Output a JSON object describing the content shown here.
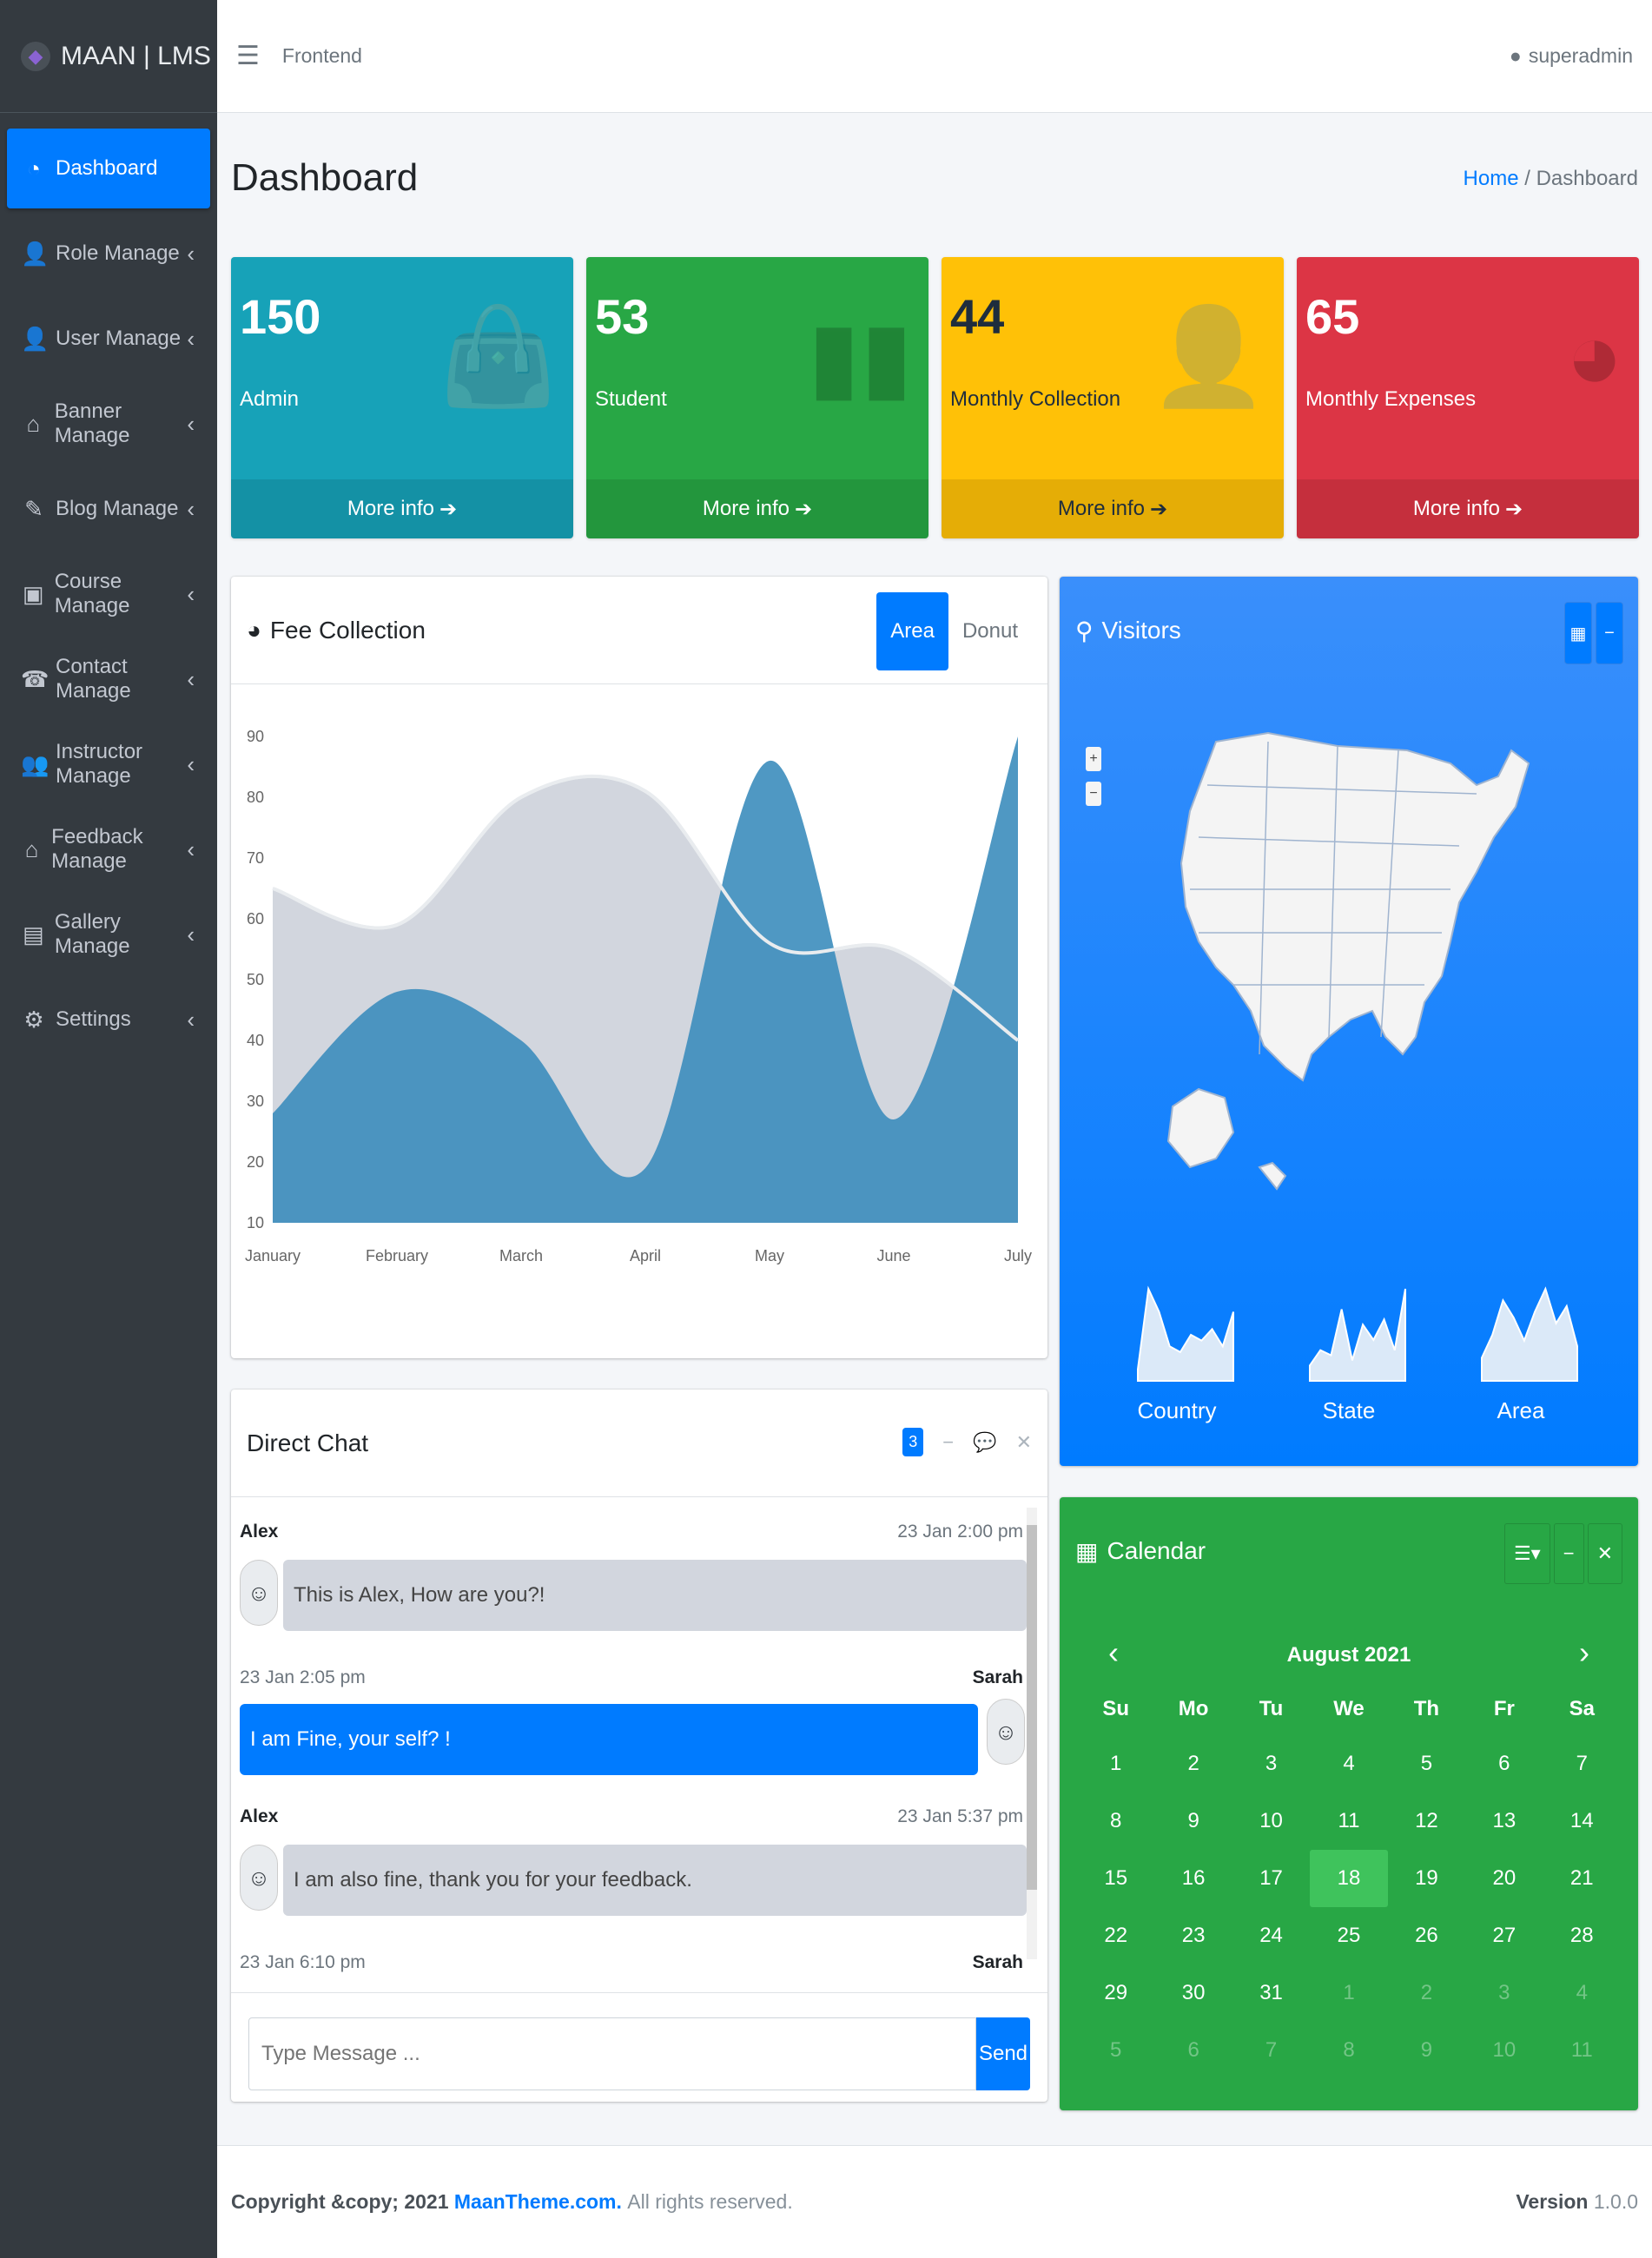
{
  "brand": {
    "name": "MAAN | LMS"
  },
  "sidebar": {
    "items": [
      {
        "label": "Dashboard",
        "icon": "dashboard-icon",
        "active": true
      },
      {
        "label": "Role Manage",
        "icon": "user-lock-icon"
      },
      {
        "label": "User Manage",
        "icon": "user-icon"
      },
      {
        "label": "Banner Manage",
        "icon": "home-icon"
      },
      {
        "label": "Blog Manage",
        "icon": "blog-icon"
      },
      {
        "label": "Course Manage",
        "icon": "course-icon"
      },
      {
        "label": "Contact Manage",
        "icon": "contact-icon"
      },
      {
        "label": "Instructor Manage",
        "icon": "users-icon"
      },
      {
        "label": "Feedback Manage",
        "icon": "home-icon"
      },
      {
        "label": "Gallery Manage",
        "icon": "gallery-icon"
      },
      {
        "label": "Settings",
        "icon": "gear-icon"
      }
    ]
  },
  "topbar": {
    "link": "Frontend",
    "user": "superadmin"
  },
  "header": {
    "title": "Dashboard",
    "breadcrumb_home": "Home",
    "breadcrumb_sep": "/",
    "breadcrumb_current": "Dashboard"
  },
  "stats": [
    {
      "value": "150",
      "label": "Admin",
      "footer": "More info",
      "color": "#17a2b8",
      "icon": "bag-icon"
    },
    {
      "value": "53",
      "label": "Student",
      "footer": "More info",
      "color": "#28a745",
      "icon": "bar-chart-icon"
    },
    {
      "value": "44",
      "label": "Monthly Collection",
      "footer": "More info",
      "color": "#ffc107",
      "icon": "user-plus-icon"
    },
    {
      "value": "65",
      "label": "Monthly Expenses",
      "footer": "More info",
      "color": "#dc3545",
      "icon": "pie-chart-icon"
    }
  ],
  "fee": {
    "title": "Fee Collection",
    "tabs": [
      "Area",
      "Donut"
    ]
  },
  "chart_data": {
    "type": "area",
    "title": "Fee Collection",
    "categories": [
      "January",
      "February",
      "March",
      "April",
      "May",
      "June",
      "July"
    ],
    "series": [
      {
        "values": [
          65,
          59,
          80,
          81,
          56,
          55,
          40
        ],
        "color": "#d2d6de"
      },
      {
        "values": [
          28,
          48,
          40,
          19,
          86,
          27,
          90
        ],
        "color": "#3c8dbc"
      }
    ],
    "ylim": [
      10,
      90
    ],
    "yticks": [
      10,
      20,
      30,
      40,
      50,
      60,
      70,
      80,
      90
    ],
    "grid": false
  },
  "visitors": {
    "title": "Visitors",
    "sparks": [
      {
        "label": "Country",
        "values": [
          10,
          80,
          60,
          30,
          25,
          40,
          35,
          45,
          30,
          60
        ]
      },
      {
        "label": "State",
        "values": [
          15,
          30,
          25,
          70,
          20,
          55,
          40,
          60,
          30,
          90
        ]
      },
      {
        "label": "Area",
        "values": [
          20,
          40,
          70,
          55,
          35,
          60,
          80,
          50,
          65,
          30
        ]
      }
    ]
  },
  "chat": {
    "title": "Direct Chat",
    "badge": "3",
    "messages": [
      {
        "name": "Alex",
        "time": "23 Jan 2:00 pm",
        "text": "This is Alex, How are you?!",
        "side": "left"
      },
      {
        "name": "Sarah",
        "time": "23 Jan 2:05 pm",
        "text": "I am Fine, your self? !",
        "side": "right"
      },
      {
        "name": "Alex",
        "time": "23 Jan 5:37 pm",
        "text": "I am also fine, thank you for your feedback.",
        "side": "left"
      },
      {
        "name": "Sarah",
        "time": "23 Jan 6:10 pm",
        "text": "",
        "side": "right"
      }
    ],
    "placeholder": "Type Message ...",
    "send": "Send"
  },
  "calendar": {
    "title": "Calendar",
    "month": "August 2021",
    "weekdays": [
      "Su",
      "Mo",
      "Tu",
      "We",
      "Th",
      "Fr",
      "Sa"
    ],
    "weeks": [
      [
        "1",
        "2",
        "3",
        "4",
        "5",
        "6",
        "7"
      ],
      [
        "8",
        "9",
        "10",
        "11",
        "12",
        "13",
        "14"
      ],
      [
        "15",
        "16",
        "17",
        "18",
        "19",
        "20",
        "21"
      ],
      [
        "22",
        "23",
        "24",
        "25",
        "26",
        "27",
        "28"
      ],
      [
        "29",
        "30",
        "31",
        "1",
        "2",
        "3",
        "4"
      ],
      [
        "5",
        "6",
        "7",
        "8",
        "9",
        "10",
        "11"
      ]
    ],
    "today": "18"
  },
  "footer": {
    "copyright": "Copyright &copy; 2021",
    "brand": "MaanTheme.com.",
    "rights": "All rights reserved.",
    "version_label": "Version",
    "version": "1.0.0"
  }
}
